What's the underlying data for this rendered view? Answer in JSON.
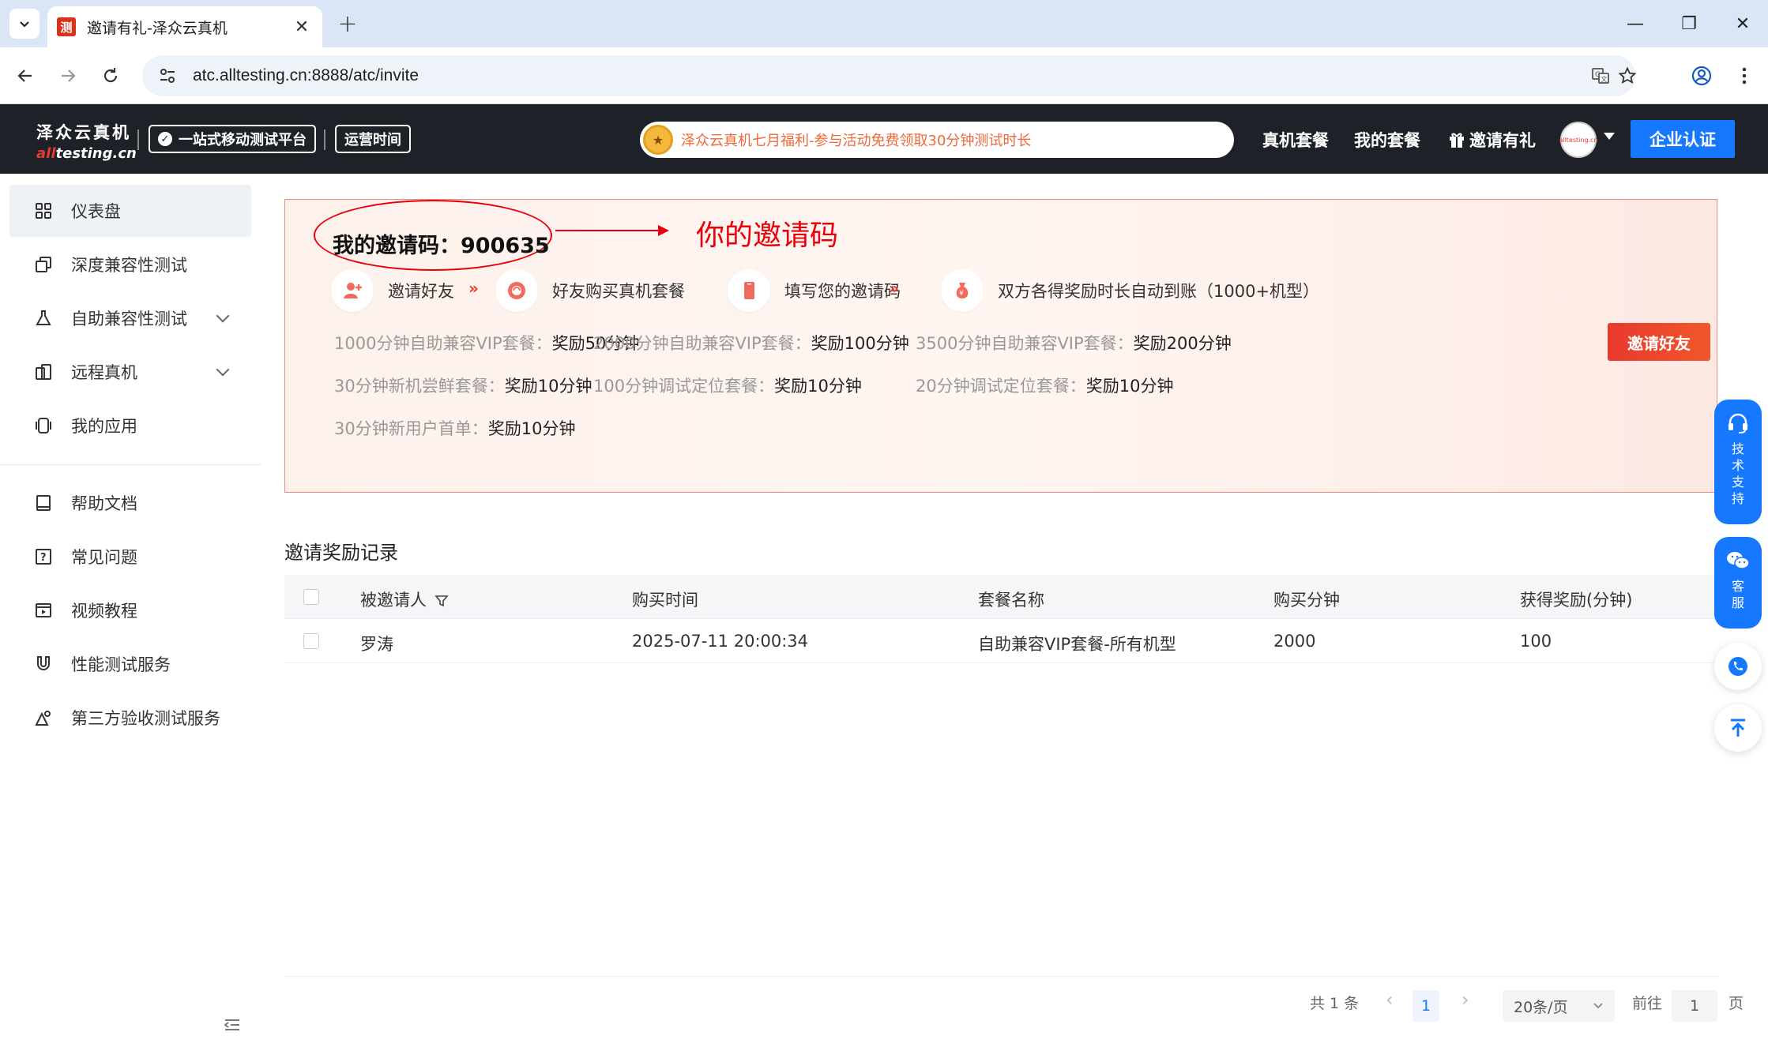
{
  "browser": {
    "tab_title": "邀请有礼-泽众云真机",
    "tab_close": "✕",
    "new_tab": "+",
    "url": "atc.alltesting.cn:8888/atc/invite",
    "window_controls": [
      "—",
      "❐",
      "✕"
    ]
  },
  "header": {
    "logo_cn": "泽众云真机",
    "logo_en_red": "all",
    "logo_en_rest": "testing.cn",
    "badge_platform": "一站式移动测试平台",
    "badge_hours": "运营时间",
    "promo_text": "泽众云真机七月福利-参与活动免费领取30分钟测试时长",
    "nav_packages": "真机套餐",
    "nav_my_packages": "我的套餐",
    "nav_invite": "邀请有礼",
    "avatar_text": "alltesting.cn",
    "enterprise_button": "企业认证"
  },
  "sidebar": {
    "items": [
      {
        "label": "仪表盘",
        "icon": "dashboard-icon"
      },
      {
        "label": "深度兼容性测试",
        "icon": "copy-icon"
      },
      {
        "label": "自助兼容性测试",
        "icon": "flask-icon"
      },
      {
        "label": "远程真机",
        "icon": "device-icon"
      },
      {
        "label": "我的应用",
        "icon": "app-icon"
      },
      {
        "label": "帮助文档",
        "icon": "book-icon"
      },
      {
        "label": "常见问题",
        "icon": "question-icon"
      },
      {
        "label": "视频教程",
        "icon": "video-icon"
      },
      {
        "label": "性能测试服务",
        "icon": "magnet-icon"
      },
      {
        "label": "第三方验收测试服务",
        "icon": "badge-icon"
      }
    ]
  },
  "invite": {
    "code_label": "我的邀请码：",
    "code_value": "900635",
    "annotation": "你的邀请码",
    "steps": [
      "邀请好友",
      "好友购买真机套餐",
      "填写您的邀请码",
      "双方各得奖励时长自动到账（1000+机型）"
    ],
    "step_arrow": "»",
    "rewards": [
      {
        "label": "1000分钟自助兼容VIP套餐：",
        "value": "奖励50分钟"
      },
      {
        "label": "2000分钟自助兼容VIP套餐：",
        "value": "奖励100分钟"
      },
      {
        "label": "3500分钟自助兼容VIP套餐：",
        "value": "奖励200分钟"
      },
      {
        "label": "30分钟新机尝鲜套餐：",
        "value": "奖励10分钟"
      },
      {
        "label": "100分钟调试定位套餐：",
        "value": "奖励10分钟"
      },
      {
        "label": "20分钟调试定位套餐：",
        "value": "奖励10分钟"
      },
      {
        "label": "30分钟新用户首单：",
        "value": "奖励10分钟"
      }
    ],
    "invite_button": "邀请好友"
  },
  "records": {
    "title": "邀请奖励记录",
    "columns": [
      "被邀请人",
      "购买时间",
      "套餐名称",
      "购买分钟",
      "获得奖励(分钟)"
    ],
    "rows": [
      [
        "罗涛",
        "2025-07-11 20:00:34",
        "自助兼容VIP套餐-所有机型",
        "2000",
        "100"
      ]
    ]
  },
  "pagination": {
    "total": "共 1 条",
    "prev": "‹",
    "current_page": "1",
    "next": "›",
    "page_size": "20条/页",
    "goto_label": "前往",
    "goto_value": "1",
    "page_suffix": "页"
  },
  "float_tools": {
    "tech_support": "技术支持",
    "customer_service": "客服"
  },
  "colors": {
    "accent": "#1677ff",
    "brand_red": "#e8392f",
    "header_bg": "#1e2128"
  }
}
